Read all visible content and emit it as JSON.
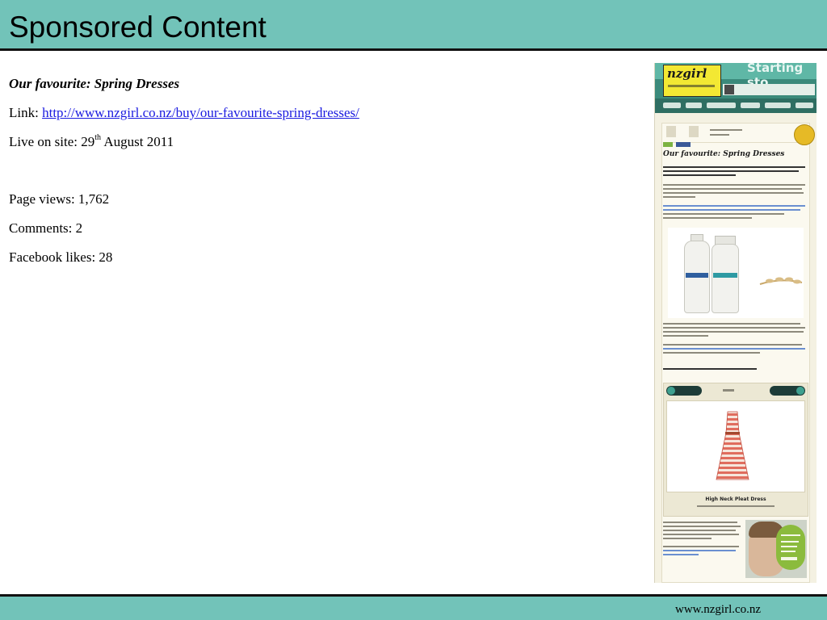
{
  "slide": {
    "title": "Sponsored Content"
  },
  "content": {
    "heading": "Our favourite:  Spring Dresses",
    "link_label": "Link: ",
    "link_url": "http://www.nzgirl.co.nz/buy/our-favourite-spring-dresses/",
    "live_label": "Live on site:  29",
    "live_day_suffix": "th",
    "live_rest": " August 2011",
    "page_views": "Page views: 1,762",
    "comments": "Comments:  2",
    "facebook_likes": "Facebook likes:  28"
  },
  "screenshot": {
    "logo": "nzgirl",
    "banner": "Starting sto",
    "article_title": "Our favourite: Spring Dresses",
    "gallery_item": "High Neck Pleat Dress"
  },
  "footer": {
    "url": "www.nzgirl.co.nz"
  },
  "colors": {
    "bar": "#72c3b9",
    "link": "#1a1ae0",
    "nzgirl_yellow": "#f3e833"
  }
}
